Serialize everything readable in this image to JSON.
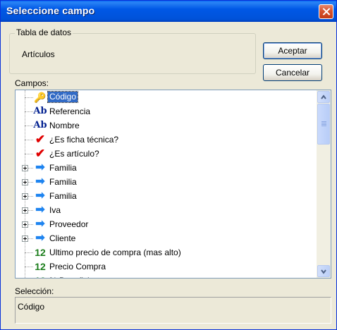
{
  "window": {
    "title": "Seleccione campo",
    "close_icon": "close-icon"
  },
  "group": {
    "legend": "Tabla de datos",
    "value": "Artículos"
  },
  "buttons": {
    "accept": "Aceptar",
    "cancel": "Cancelar"
  },
  "fields": {
    "label": "Campos:",
    "items": [
      {
        "icon": "key-icon",
        "glyph": "🔑",
        "label": "Código",
        "selected": true,
        "expandable": false
      },
      {
        "icon": "text-field-icon",
        "glyph": "Ab",
        "label": "Referencia",
        "selected": false,
        "expandable": false
      },
      {
        "icon": "text-field-icon",
        "glyph": "Ab",
        "label": "Nombre",
        "selected": false,
        "expandable": false
      },
      {
        "icon": "boolean-check-icon",
        "glyph": "✔",
        "label": "¿Es ficha técnica?",
        "selected": false,
        "expandable": false
      },
      {
        "icon": "boolean-check-icon",
        "glyph": "✔",
        "label": "¿Es artículo?",
        "selected": false,
        "expandable": false
      },
      {
        "icon": "relation-arrow-icon",
        "glyph": "➡",
        "label": "Familia",
        "selected": false,
        "expandable": true
      },
      {
        "icon": "relation-arrow-icon",
        "glyph": "➡",
        "label": "Familia",
        "selected": false,
        "expandable": true
      },
      {
        "icon": "relation-arrow-icon",
        "glyph": "➡",
        "label": "Familia",
        "selected": false,
        "expandable": true
      },
      {
        "icon": "relation-arrow-icon",
        "glyph": "➡",
        "label": "Iva",
        "selected": false,
        "expandable": true
      },
      {
        "icon": "relation-arrow-icon",
        "glyph": "➡",
        "label": "Proveedor",
        "selected": false,
        "expandable": true
      },
      {
        "icon": "relation-arrow-icon",
        "glyph": "➡",
        "label": "Cliente",
        "selected": false,
        "expandable": true
      },
      {
        "icon": "numeric-field-icon",
        "glyph": "12",
        "label": "Ultimo precio de compra (mas alto)",
        "selected": false,
        "expandable": false
      },
      {
        "icon": "numeric-field-icon",
        "glyph": "12",
        "label": "Precio Compra",
        "selected": false,
        "expandable": false
      },
      {
        "icon": "numeric-field-icon",
        "glyph": "12",
        "label": "% Beneficio",
        "selected": false,
        "expandable": false
      }
    ]
  },
  "selection": {
    "label": "Selección:",
    "value": "Código"
  },
  "colors": {
    "title_bar": "#0058e6",
    "selection": "#316ac5",
    "text_icon": "#001f8f",
    "numeric_icon": "#1b7d1b",
    "check_icon": "#e00000",
    "arrow_icon": "#1e84f0"
  }
}
